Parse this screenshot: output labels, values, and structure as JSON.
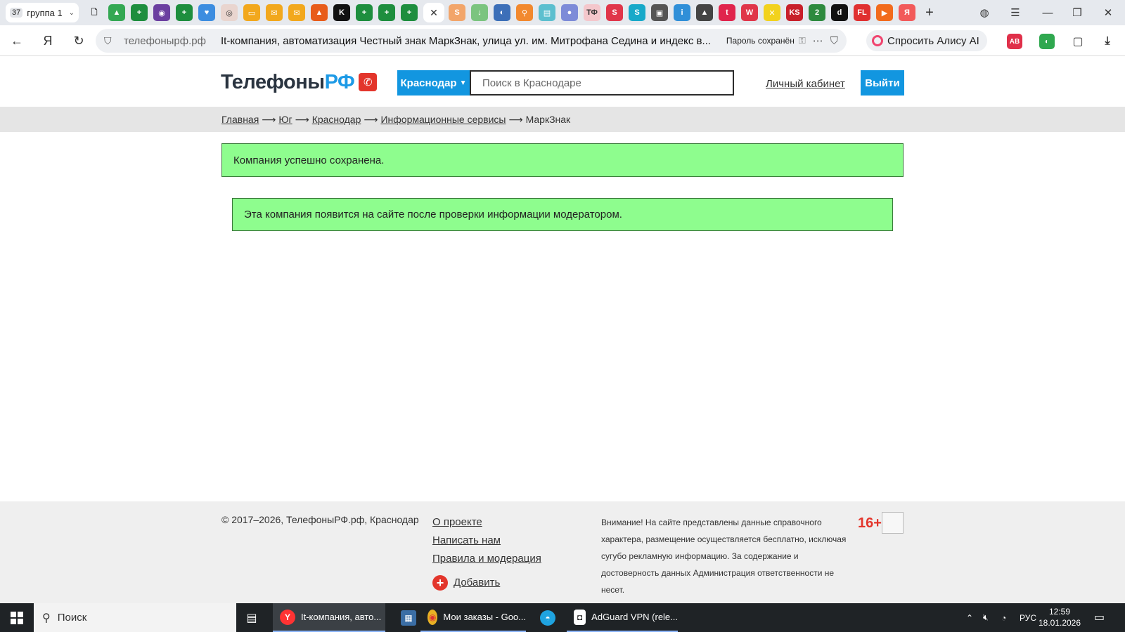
{
  "browser": {
    "group_count": "37",
    "group_label": "группа 1",
    "tab_icons": [
      {
        "name": "doc-icon",
        "glyph": "🗋",
        "color": "transparent"
      },
      {
        "name": "drive-icon",
        "glyph": "▲",
        "color": "#34a853"
      },
      {
        "name": "sheets-icon",
        "glyph": "+",
        "color": "#1e8e3e"
      },
      {
        "name": "tor-icon",
        "glyph": "◉",
        "color": "#6b3fa0"
      },
      {
        "name": "sheets-icon",
        "glyph": "+",
        "color": "#1e8e3e"
      },
      {
        "name": "heart-icon",
        "glyph": "♥",
        "color": "#3c8de0"
      },
      {
        "name": "circle-icon",
        "glyph": "◎",
        "color": "#e9d5cf"
      },
      {
        "name": "chat-icon",
        "glyph": "▭",
        "color": "#f2a81d"
      },
      {
        "name": "mail-icon",
        "glyph": "✉",
        "color": "#f2a81d"
      },
      {
        "name": "mail-icon",
        "glyph": "✉",
        "color": "#f2a81d"
      },
      {
        "name": "flame-icon",
        "glyph": "▲",
        "color": "#e85c1a"
      },
      {
        "name": "k-icon",
        "glyph": "K",
        "color": "#111111"
      },
      {
        "name": "sheets-icon",
        "glyph": "+",
        "color": "#1e8e3e"
      },
      {
        "name": "sheets-icon",
        "glyph": "+",
        "color": "#1e8e3e"
      },
      {
        "name": "sheets-icon",
        "glyph": "+",
        "color": "#1e8e3e"
      }
    ],
    "active_tab_close": "✕",
    "tab_icons_after": [
      {
        "name": "s-icon",
        "glyph": "S",
        "color": "#f2a56a"
      },
      {
        "name": "arrow-down-icon",
        "glyph": "↓",
        "color": "#7bc47f"
      },
      {
        "name": "globe-icon",
        "glyph": "◐",
        "color": "#3c6fb8"
      },
      {
        "name": "search-orange-icon",
        "glyph": "⚲",
        "color": "#f2892f"
      },
      {
        "name": "briefcase-icon",
        "glyph": "▤",
        "color": "#5cbfcf"
      },
      {
        "name": "pin-icon",
        "glyph": "●",
        "color": "#7d8bd8"
      },
      {
        "name": "tf-icon",
        "glyph": "ТФ",
        "color": "#f4c7cc"
      },
      {
        "name": "s-red-icon",
        "glyph": "S",
        "color": "#e0364a"
      },
      {
        "name": "s-cyan-icon",
        "glyph": "S",
        "color": "#17a9c9"
      },
      {
        "name": "wallet-icon",
        "glyph": "▣",
        "color": "#555555"
      },
      {
        "name": "info-icon",
        "glyph": "i",
        "color": "#2f8fd8"
      },
      {
        "name": "bank-icon",
        "glyph": "▲",
        "color": "#444444"
      },
      {
        "name": "t-icon",
        "glyph": "t",
        "color": "#e0244c"
      },
      {
        "name": "w-icon",
        "glyph": "W",
        "color": "#e0364a"
      },
      {
        "name": "x-yellow-icon",
        "glyph": "✕",
        "color": "#f2d21d"
      },
      {
        "name": "ks-icon",
        "glyph": "KS",
        "color": "#c8202a"
      },
      {
        "name": "two-icon",
        "glyph": "2",
        "color": "#2d8a3e"
      },
      {
        "name": "d-icon",
        "glyph": "d",
        "color": "#111111"
      },
      {
        "name": "fl-icon",
        "glyph": "FL",
        "color": "#e03030"
      },
      {
        "name": "play-icon",
        "glyph": "▶",
        "color": "#f26b1d"
      },
      {
        "name": "yandex-icon",
        "glyph": "Я",
        "color": "#f25a5a"
      }
    ],
    "new_tab_glyph": "+",
    "url_domain": "телефонырф.рф",
    "page_title": "It-компания, автоматизация Честный знак МаркЗнак, улица ул. им. Митрофана Седина и индекс в...",
    "password_saved": "Пароль сохранён",
    "alice_button": "Спросить Алису AI"
  },
  "site": {
    "logo_text": "Телефоны",
    "logo_accent": "РФ",
    "city": "Краснодар",
    "search_placeholder": "Поиск в Краснодаре",
    "cabinet_link": "Личный кабинет",
    "logout_button": "Выйти",
    "breadcrumb": {
      "items": [
        "Главная",
        "Юг",
        "Краснодар",
        "Информационные сервисы"
      ],
      "current": "МаркЗнак",
      "separator": "⟶"
    },
    "alerts": [
      "Компания успешно сохранена.",
      "Эта компания появится на сайте после проверки информации модератором."
    ],
    "footer": {
      "copyright": "© 2017–2026, ТелефоныРФ.рф, Краснодар",
      "links": [
        "О проекте",
        "Написать нам",
        "Правила и модерация"
      ],
      "add_link": "Добавить",
      "disclaimer": "Внимание! На сайте представлены данные справочного характера, размещение осуществляется бесплатно, исключая сугубо рекламную информацию. За содержание и достоверность данных Администрация ответственности не несет.",
      "age_rating": "16+"
    }
  },
  "taskbar": {
    "search_placeholder": "Поиск",
    "apps": [
      {
        "label": "It-компания, авто...",
        "icon": "Y",
        "icon_color": "#ff3333",
        "active": true
      },
      {
        "label": "",
        "icon": "▦",
        "icon_color": "#3b6ea5",
        "active": false
      },
      {
        "label": "Мои заказы - Goo...",
        "icon": "◉",
        "icon_color": "#e8b024",
        "active": false
      },
      {
        "label": "",
        "icon": "◓",
        "icon_color": "#1fa3e0",
        "active": false
      },
      {
        "label": "AdGuard VPN (rele...",
        "icon": "◘",
        "icon_color": "#ffffff",
        "active": false
      }
    ],
    "lang": "РУС",
    "time": "12:59",
    "date": "18.01.2026"
  }
}
